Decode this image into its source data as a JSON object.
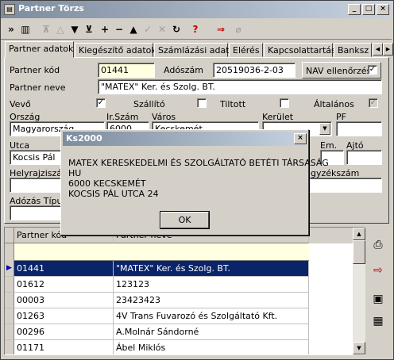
{
  "window": {
    "title": "Partner Törzs",
    "icon": "app-icon"
  },
  "toolbar": {
    "icons": [
      "expand-icon",
      "grid-icon",
      "first-icon",
      "prev-icon",
      "next-icon",
      "last-icon",
      "add-icon",
      "delete-icon",
      "up-icon",
      "confirm-icon",
      "cancel-icon",
      "refresh-icon",
      "query-icon",
      "export-icon",
      "attach-icon"
    ]
  },
  "tabs": [
    "Partner adatok",
    "Kiegészítő adatok",
    "Számlázási adatok",
    "Elérés",
    "Kapcsolattartás",
    "Banksz"
  ],
  "form": {
    "partner_kod_label": "Partner kód",
    "partner_kod": "01441",
    "adoszam_label": "Adószám",
    "adoszam": "20519036-2-03",
    "nav_label": "NAV ellenőrzés",
    "partner_neve_label": "Partner neve",
    "partner_neve": "\"MATEX\" Ker. és Szolg. BT.",
    "vevo_label": "Vevő",
    "szallito_label": "Szállító",
    "tiltott_label": "Tiltott",
    "altalanos_label": "Általános",
    "orszag_label": "Ország",
    "orszag": "Magyarország",
    "irszam_label": "Ir.Szám",
    "irszam": "6000",
    "varos_label": "Város",
    "varos": "Kecskemét",
    "kerulet_label": "Kerület",
    "pf_label": "PF",
    "utca_label": "Utca",
    "utca": "Kocsis Pál",
    "em_label": "Em.",
    "ajto_label": "Ajtó",
    "helyrajziszam_label": "Helyrajziszám",
    "cegjegyzekszam_label": "gyzékszám",
    "adozas_label": "Adózás Típus"
  },
  "grid": {
    "columns": [
      "Partner kód",
      "Partner neve"
    ],
    "rows": [
      {
        "kod": "01441",
        "nev": "\"MATEX\" Ker. és Szolg. BT."
      },
      {
        "kod": "01612",
        "nev": "123123"
      },
      {
        "kod": "00003",
        "nev": "23423423"
      },
      {
        "kod": "01263",
        "nev": "4V Trans Fuvarozó és Szolgáltató Kft."
      },
      {
        "kod": "00296",
        "nev": "A.Molnár Sándorné"
      },
      {
        "kod": "01171",
        "nev": "Ábel Miklós"
      }
    ]
  },
  "dialog": {
    "title": "Ks2000",
    "line1": "MATEX KERESKEDELMI ÉS SZOLGÁLTATÓ BETÉTI TÁRSASÁG",
    "line2": "HU",
    "line3": "6000 KECSKEMÉT",
    "line4": "KOCSIS PÁL UTCA 24",
    "ok": "OK"
  }
}
